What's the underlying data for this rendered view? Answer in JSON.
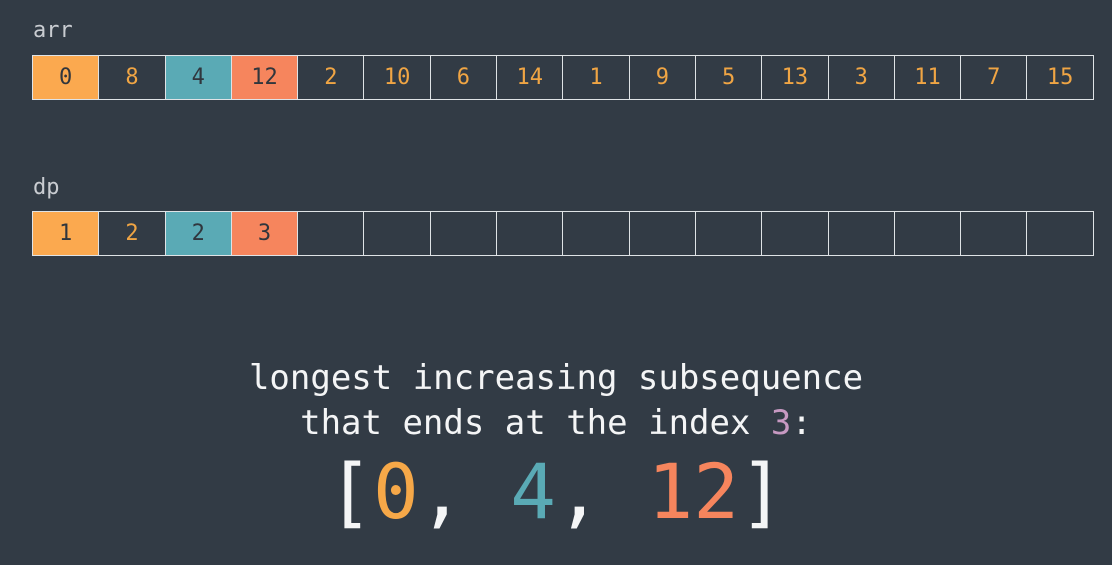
{
  "arr": {
    "label": "arr",
    "values": [
      "0",
      "8",
      "4",
      "12",
      "2",
      "10",
      "6",
      "14",
      "1",
      "9",
      "5",
      "13",
      "3",
      "11",
      "7",
      "15"
    ],
    "highlights": [
      "orange",
      "none",
      "teal",
      "red",
      "none",
      "none",
      "none",
      "none",
      "none",
      "none",
      "none",
      "none",
      "none",
      "none",
      "none",
      "none"
    ]
  },
  "dp": {
    "label": "dp",
    "values": [
      "1",
      "2",
      "2",
      "3",
      "",
      "",
      "",
      "",
      "",
      "",
      "",
      "",
      "",
      "",
      "",
      ""
    ],
    "highlights": [
      "orange",
      "none",
      "teal",
      "red",
      "none",
      "none",
      "none",
      "none",
      "none",
      "none",
      "none",
      "none",
      "none",
      "none",
      "none",
      "none"
    ]
  },
  "caption": {
    "line1": "longest increasing subsequence",
    "line2_prefix": "that ends at the index ",
    "line2_index": "3",
    "line2_suffix": ":"
  },
  "result": {
    "open": "[",
    "values": [
      "0",
      "4",
      "12"
    ],
    "sep1": ", ",
    "sep2": ", ",
    "close": "]"
  },
  "colors": {
    "background": "#323b45",
    "orange": "#fba94f",
    "teal": "#5aaab5",
    "red": "#f6855d",
    "cell_text": "#f0a544",
    "index_highlight": "#c799c2"
  }
}
